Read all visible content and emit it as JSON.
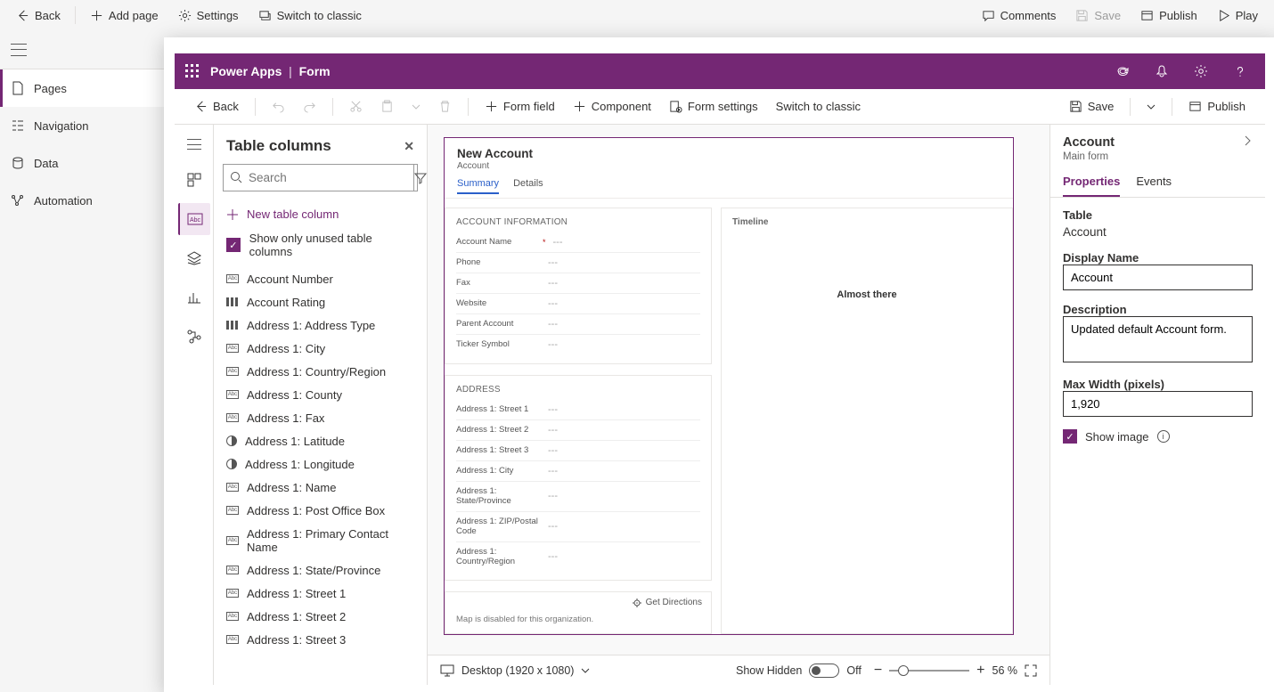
{
  "outer_cmd": {
    "back": "Back",
    "add_page": "Add page",
    "settings": "Settings",
    "switch_classic": "Switch to classic",
    "comments": "Comments",
    "save": "Save",
    "publish": "Publish",
    "play": "Play"
  },
  "outer_nav": {
    "pages": "Pages",
    "navigation": "Navigation",
    "data": "Data",
    "automation": "Automation"
  },
  "editor_header": {
    "product": "Power Apps",
    "context": "Form"
  },
  "editor_cmd": {
    "back": "Back",
    "form_field": "Form field",
    "component": "Component",
    "form_settings": "Form settings",
    "switch_classic": "Switch to classic",
    "save": "Save",
    "publish": "Publish"
  },
  "table_columns": {
    "title": "Table columns",
    "search_placeholder": "Search",
    "new": "New table column",
    "show_only": "Show only unused table columns",
    "items": [
      {
        "type": "abc",
        "label": "Account Number"
      },
      {
        "type": "opt",
        "label": "Account Rating"
      },
      {
        "type": "opt",
        "label": "Address 1: Address Type"
      },
      {
        "type": "abc",
        "label": "Address 1: City"
      },
      {
        "type": "abc",
        "label": "Address 1: Country/Region"
      },
      {
        "type": "abc",
        "label": "Address 1: County"
      },
      {
        "type": "abc",
        "label": "Address 1: Fax"
      },
      {
        "type": "globe",
        "label": "Address 1: Latitude"
      },
      {
        "type": "globe",
        "label": "Address 1: Longitude"
      },
      {
        "type": "abc",
        "label": "Address 1: Name"
      },
      {
        "type": "abc",
        "label": "Address 1: Post Office Box"
      },
      {
        "type": "abc",
        "label": "Address 1: Primary Contact Name"
      },
      {
        "type": "abc",
        "label": "Address 1: State/Province"
      },
      {
        "type": "abc",
        "label": "Address 1: Street 1"
      },
      {
        "type": "abc",
        "label": "Address 1: Street 2"
      },
      {
        "type": "abc",
        "label": "Address 1: Street 3"
      }
    ]
  },
  "form_canvas": {
    "title": "New Account",
    "subtitle": "Account",
    "tabs": [
      "Summary",
      "Details"
    ],
    "sec_account": "ACCOUNT INFORMATION",
    "fields_account": [
      {
        "label": "Account Name",
        "required": true
      },
      {
        "label": "Phone"
      },
      {
        "label": "Fax"
      },
      {
        "label": "Website"
      },
      {
        "label": "Parent Account"
      },
      {
        "label": "Ticker Symbol"
      }
    ],
    "sec_address": "ADDRESS",
    "fields_address": [
      {
        "label": "Address 1: Street 1"
      },
      {
        "label": "Address 1: Street 2"
      },
      {
        "label": "Address 1: Street 3"
      },
      {
        "label": "Address 1: City"
      },
      {
        "label": "Address 1: State/Province"
      },
      {
        "label": "Address 1: ZIP/Postal Code"
      },
      {
        "label": "Address 1: Country/Region"
      }
    ],
    "timeline": "Timeline",
    "almost": "Almost there",
    "get_directions": "Get Directions",
    "map_note": "Map is disabled for this organization."
  },
  "footer": {
    "viewport": "Desktop (1920 x 1080)",
    "show_hidden": "Show Hidden",
    "toggle_state": "Off",
    "zoom_pct": "56 %"
  },
  "props": {
    "title": "Account",
    "subtitle": "Main form",
    "tabs": [
      "Properties",
      "Events"
    ],
    "table_label": "Table",
    "table_value": "Account",
    "display_label": "Display Name",
    "display_value": "Account",
    "desc_label": "Description",
    "desc_value": "Updated default Account form.",
    "maxw_label": "Max Width (pixels)",
    "maxw_value": "1,920",
    "show_image": "Show image"
  }
}
